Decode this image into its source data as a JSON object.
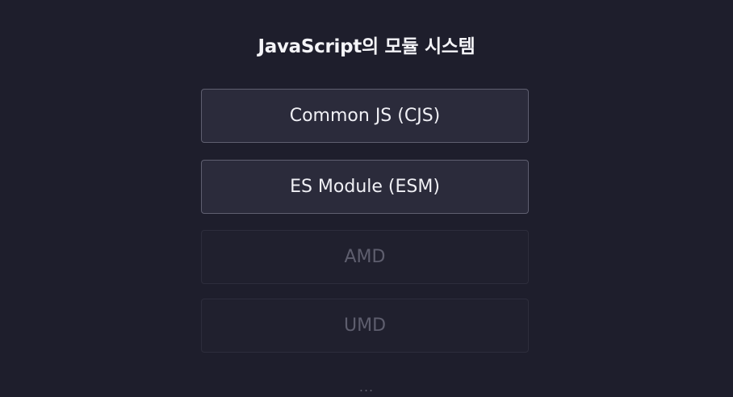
{
  "title": "JavaScript의 모듈 시스템",
  "items": [
    {
      "label": "Common JS (CJS)",
      "state": "active"
    },
    {
      "label": "ES Module (ESM)",
      "state": "active"
    },
    {
      "label": "AMD",
      "state": "dim"
    },
    {
      "label": "UMD",
      "state": "dim"
    }
  ],
  "ellipsis": "...",
  "colors": {
    "background": "#1e1e2c",
    "active_box": "#2b2b3b",
    "active_border": "#5f5f70",
    "dim_text": "#5e5e6e"
  }
}
